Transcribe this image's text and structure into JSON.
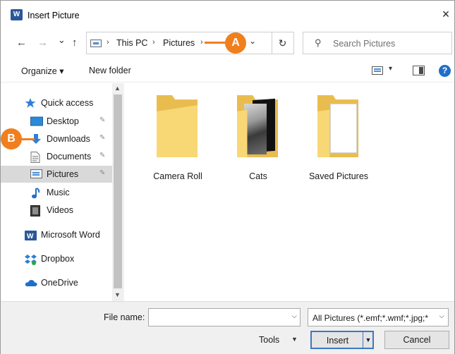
{
  "window": {
    "title": "Insert Picture",
    "app_icon_letter": "W",
    "close_glyph": "×"
  },
  "nav": {
    "back_glyph": "←",
    "forward_glyph": "→",
    "recent_glyph": "⌄",
    "up_glyph": "↑",
    "breadcrumb": [
      "This PC",
      "Pictures"
    ],
    "separator": "›",
    "refresh_glyph": "↻",
    "dropdown_glyph": "⌄",
    "search_placeholder": "Search Pictures"
  },
  "toolbar": {
    "organize_label": "Organize ▾",
    "new_folder_label": "New folder",
    "view_dropdown_glyph": "▾",
    "help_glyph": "?"
  },
  "sidebar": {
    "items": [
      {
        "label": "Quick access",
        "icon": "star-icon"
      },
      {
        "label": "Desktop",
        "icon": "desktop-icon",
        "pinned": true
      },
      {
        "label": "Downloads",
        "icon": "download-icon",
        "pinned": true
      },
      {
        "label": "Documents",
        "icon": "document-icon",
        "pinned": true
      },
      {
        "label": "Pictures",
        "icon": "pictures-icon",
        "pinned": true,
        "selected": true
      },
      {
        "label": "Music",
        "icon": "music-icon"
      },
      {
        "label": "Videos",
        "icon": "videos-icon"
      },
      {
        "label": "Microsoft Word",
        "icon": "word-icon"
      },
      {
        "label": "Dropbox",
        "icon": "dropbox-icon"
      },
      {
        "label": "OneDrive",
        "icon": "onedrive-icon"
      }
    ],
    "pin_glyph": "📌"
  },
  "folders": [
    {
      "label": "Camera Roll",
      "thumbnail": "empty"
    },
    {
      "label": "Cats",
      "thumbnail": "photos"
    },
    {
      "label": "Saved Pictures",
      "thumbnail": "paper"
    }
  ],
  "bottom": {
    "file_name_label": "File name:",
    "file_name_value": "",
    "filter_value": "All Pictures (*.emf;*.wmf;*.jpg;*",
    "tools_label": "Tools",
    "insert_label": "Insert",
    "cancel_label": "Cancel"
  },
  "callouts": {
    "a": "A",
    "b": "B"
  },
  "colors": {
    "callout": "#f07f1e",
    "selected_bg": "#d9d9d9",
    "accent": "#3b78c4",
    "folder": "#f8d775"
  }
}
